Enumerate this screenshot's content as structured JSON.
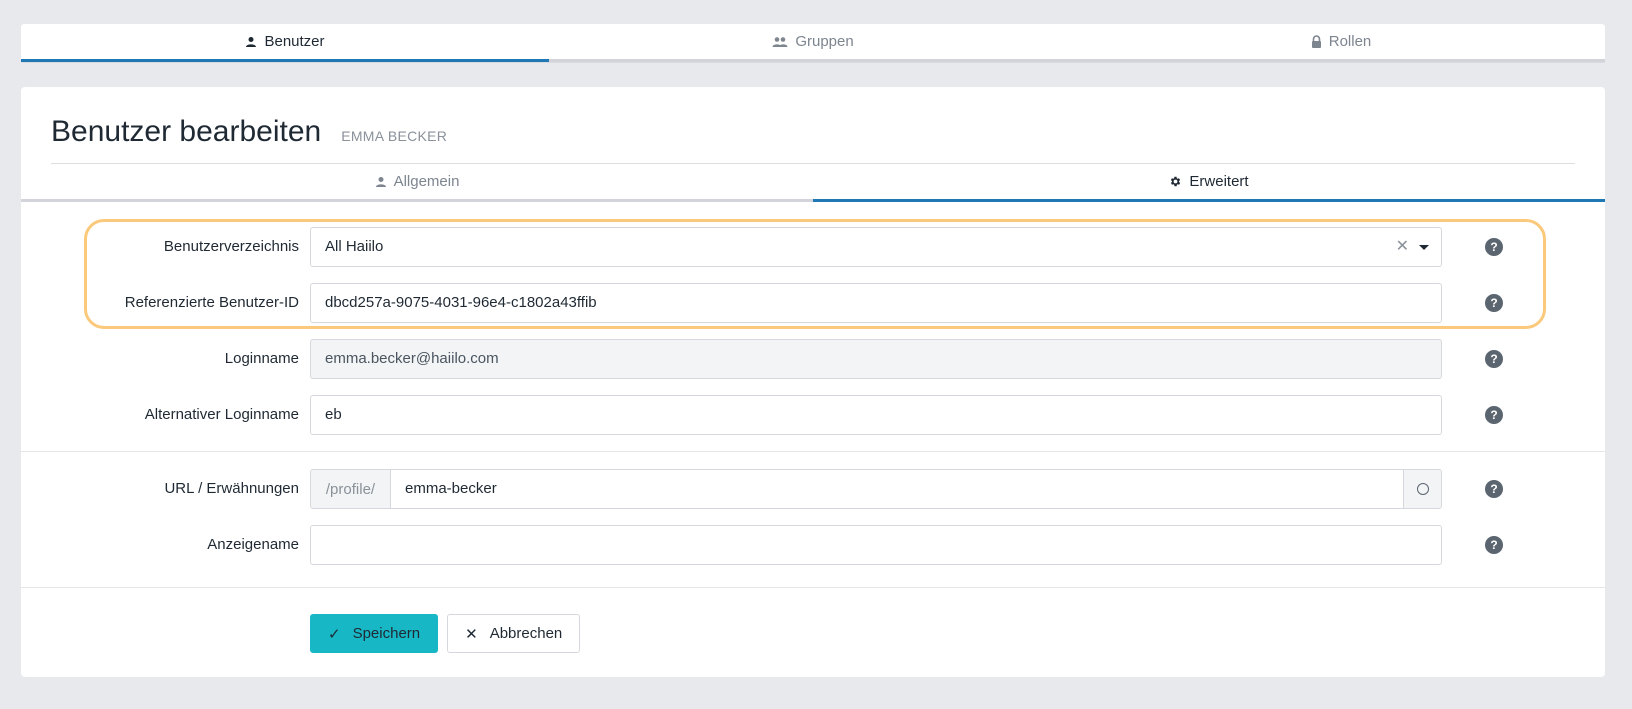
{
  "top_tabs": [
    {
      "label": "Benutzer",
      "icon": "user-icon",
      "active": true
    },
    {
      "label": "Gruppen",
      "icon": "users-icon",
      "active": false
    },
    {
      "label": "Rollen",
      "icon": "lock-icon",
      "active": false
    }
  ],
  "header": {
    "title": "Benutzer bearbeiten",
    "subtitle": "EMMA BECKER"
  },
  "inner_tabs": [
    {
      "label": "Allgemein",
      "icon": "user-icon",
      "active": false
    },
    {
      "label": "Erweitert",
      "icon": "gear-icon",
      "active": true
    }
  ],
  "form": {
    "user_directory": {
      "label": "Benutzerverzeichnis",
      "value": "All Haiilo"
    },
    "referenced_user_id": {
      "label": "Referenzierte Benutzer-ID",
      "value": "dbcd257a-9075-4031-96e4-c1802a43ffib"
    },
    "login_name": {
      "label": "Loginname",
      "value": "emma.becker@haiilo.com"
    },
    "alt_login_name": {
      "label": "Alternativer Loginname",
      "value": "eb"
    },
    "url": {
      "label": "URL / Erwähnungen",
      "prefix": "/profile/",
      "value": "emma-becker"
    },
    "display_name": {
      "label": "Anzeigename",
      "value": ""
    }
  },
  "actions": {
    "save_label": "Speichern",
    "cancel_label": "Abbrechen"
  },
  "colors": {
    "accent": "#1f77b4",
    "primary_button": "#18b7c6",
    "highlight": "#fbc97b"
  }
}
